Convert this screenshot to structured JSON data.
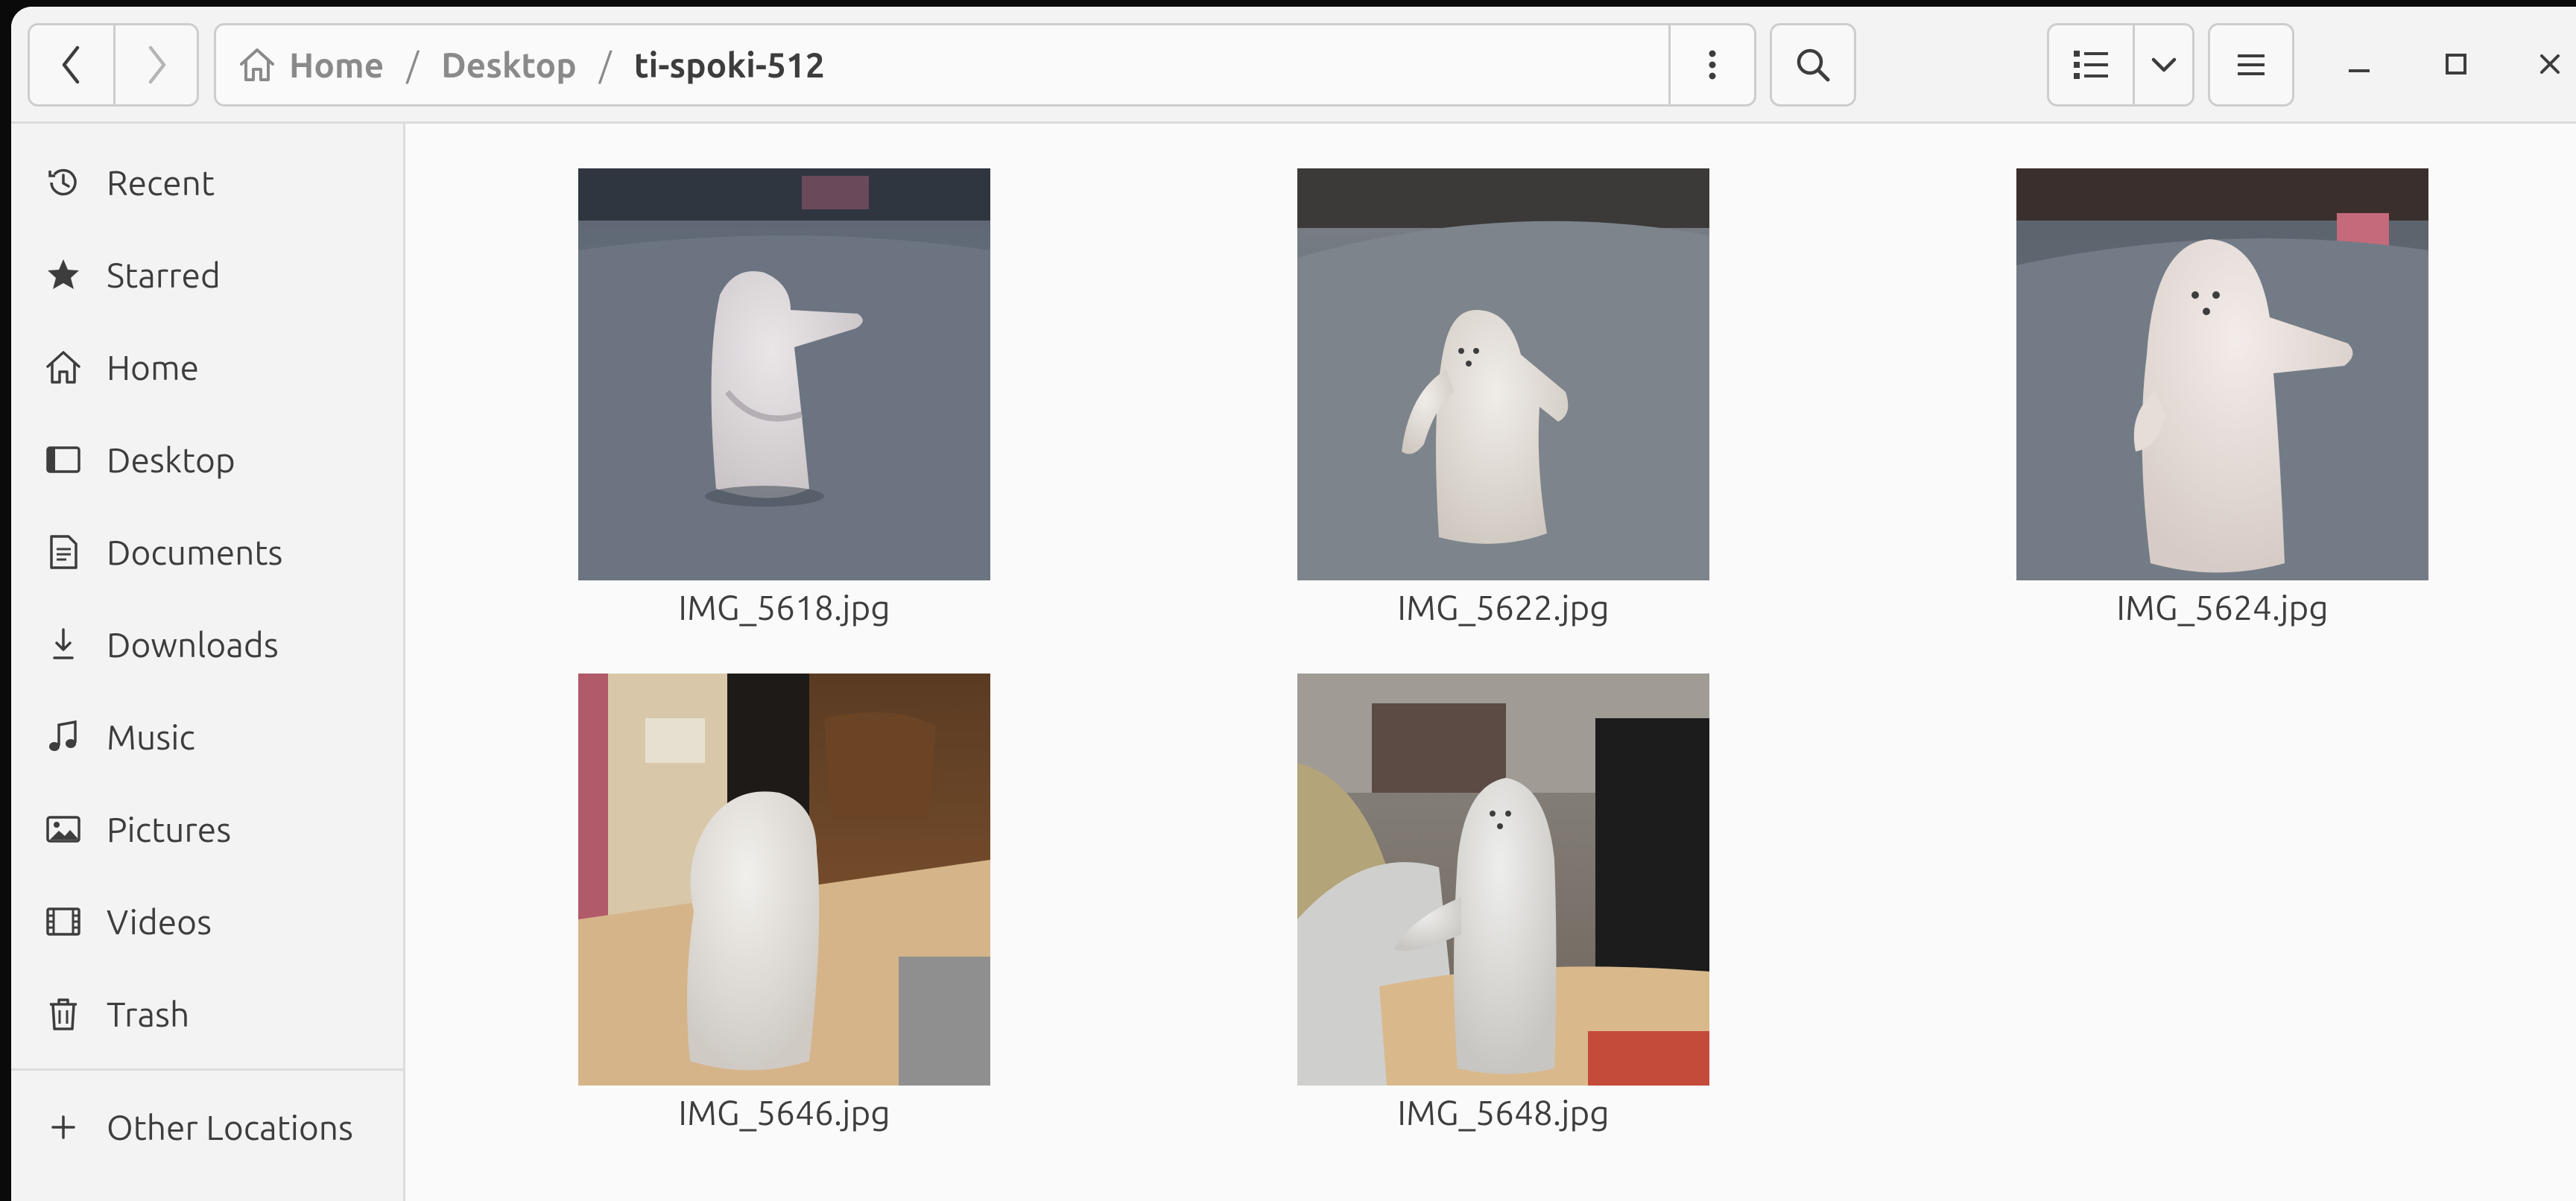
{
  "window": {
    "path": [
      "Home",
      "Desktop",
      "ti-spoki-512"
    ]
  },
  "sidebar": {
    "items": [
      {
        "label": "Recent",
        "icon": "clock-icon"
      },
      {
        "label": "Starred",
        "icon": "star-icon"
      },
      {
        "label": "Home",
        "icon": "home-icon"
      },
      {
        "label": "Desktop",
        "icon": "desktop-icon"
      },
      {
        "label": "Documents",
        "icon": "document-icon"
      },
      {
        "label": "Downloads",
        "icon": "download-icon"
      },
      {
        "label": "Music",
        "icon": "music-icon"
      },
      {
        "label": "Pictures",
        "icon": "picture-icon"
      },
      {
        "label": "Videos",
        "icon": "video-icon"
      },
      {
        "label": "Trash",
        "icon": "trash-icon"
      }
    ],
    "other_locations": "Other Locations"
  },
  "files": [
    {
      "name": "IMG_5618.jpg"
    },
    {
      "name": "IMG_5622.jpg"
    },
    {
      "name": "IMG_5624.jpg"
    },
    {
      "name": "IMG_5646.jpg"
    },
    {
      "name": "IMG_5648.jpg"
    }
  ],
  "colors": {
    "window_bg": "#fafafa",
    "sidebar_bg": "#f3f3f3",
    "text": "#3d3d3d",
    "dim_text": "#8a8a8a"
  }
}
